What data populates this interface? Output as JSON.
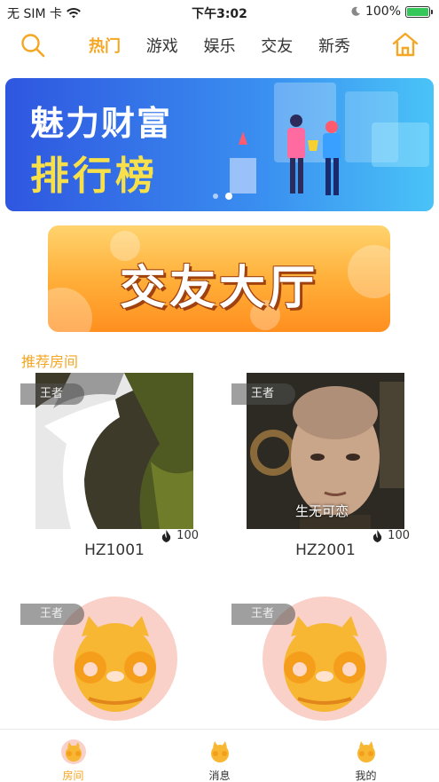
{
  "status_bar": {
    "carrier": "无 SIM 卡",
    "time": "下午3:02",
    "battery_percent": "100%",
    "battery_level": 1.0
  },
  "nav": {
    "search_icon": "search-icon",
    "home_icon": "home-icon",
    "tabs": [
      {
        "label": "热门",
        "active": true
      },
      {
        "label": "游戏",
        "active": false
      },
      {
        "label": "娱乐",
        "active": false
      },
      {
        "label": "交友",
        "active": false
      },
      {
        "label": "新秀",
        "active": false
      }
    ]
  },
  "banner": {
    "line1": "魅力财富",
    "line2": "排行榜",
    "slide_count": 2,
    "active_slide": 2
  },
  "hall": {
    "label": "交友大厅"
  },
  "section": {
    "title": "推荐房间"
  },
  "rooms": [
    {
      "name": "HZ1001",
      "badge": "王者",
      "heat": "100",
      "caption": ""
    },
    {
      "name": "HZ2001",
      "badge": "王者",
      "heat": "100",
      "caption": "生无可恋"
    },
    {
      "name": "",
      "badge": "王者",
      "heat": "",
      "caption": ""
    },
    {
      "name": "",
      "badge": "王者",
      "heat": "",
      "caption": ""
    }
  ],
  "tab_bar": {
    "items": [
      {
        "label": "房间",
        "active": true
      },
      {
        "label": "消息",
        "active": false
      },
      {
        "label": "我的",
        "active": false
      }
    ]
  },
  "colors": {
    "accent": "#f5a623",
    "banner_blue": "#2f56e0",
    "banner_yellow": "#f8e04a",
    "hall_orange": "#ff8f1f",
    "avatar_bg": "#f9d1c8"
  }
}
